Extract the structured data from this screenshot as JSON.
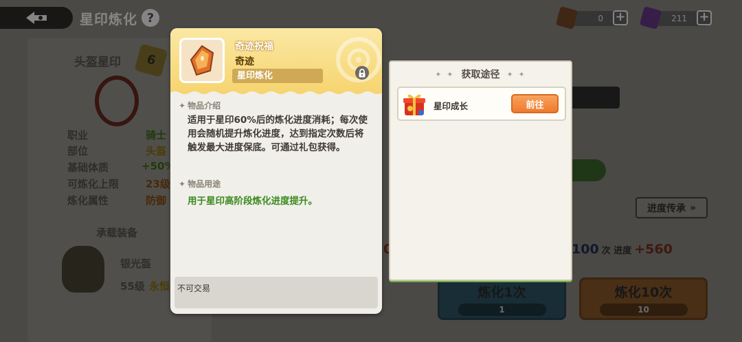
{
  "header": {
    "title": "星印炼化",
    "help": "?"
  },
  "currencies": [
    {
      "icon": "bronze-crystal-icon",
      "value": "0",
      "color": "#7b4a2a"
    },
    {
      "icon": "purple-crystal-icon",
      "value": "211",
      "color": "#6a3a8c"
    }
  ],
  "left_panel": {
    "slot_title": "头盔星印",
    "star_level": "6",
    "stats": [
      {
        "label": "职业",
        "value": "骑士"
      },
      {
        "label": "部位",
        "value": "头盔"
      },
      {
        "label": "基础体质",
        "value": "+50%"
      },
      {
        "label": "可炼化上限",
        "value": "23级"
      },
      {
        "label": "炼化属性",
        "value": "防御"
      }
    ],
    "equip_section": "承载装备",
    "equip_name": "银光盔",
    "equip_level": "55级",
    "equip_tag": "永恒"
  },
  "right_panel": {
    "inherit_label": "进度传承",
    "progress_count": "100",
    "progress_unit": "次 进度",
    "progress_gain": "+560",
    "progress_left_digit": "0",
    "refine_1_label": "炼化1次",
    "refine_1_cost": "1",
    "refine_10_label": "炼化10次",
    "refine_10_cost": "10"
  },
  "item_dialog": {
    "name": "奇迹祝福",
    "rarity": "奇迹",
    "category": "星印炼化",
    "intro_title": "物品介绍",
    "intro_text": "适用于星印60%后的炼化进度消耗；每次使用会随机提升炼化进度，达到指定次数后将触发最大进度保底。可通过礼包获得。",
    "use_title": "物品用途",
    "use_text": "用于星印高阶段炼化进度提升。",
    "trade_note": "不可交易"
  },
  "source_dialog": {
    "title": "获取途径",
    "sources": [
      {
        "label": "星印成长",
        "button": "前往"
      }
    ]
  }
}
